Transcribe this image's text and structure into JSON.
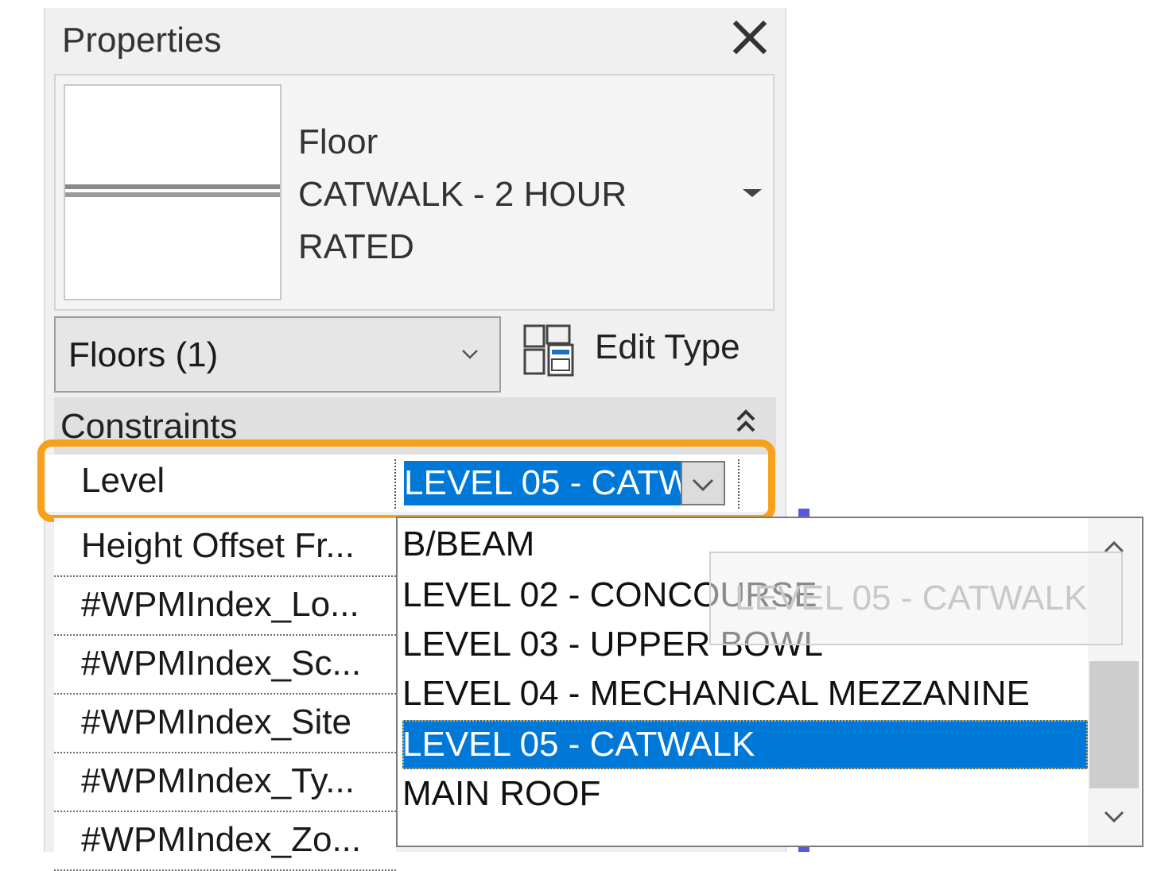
{
  "panel": {
    "title": "Properties"
  },
  "type_selector": {
    "family": "Floor",
    "type_line1": "CATWALK - 2 HOUR",
    "type_line2": "RATED"
  },
  "category_filter": {
    "value": "Floors (1)"
  },
  "edit_type": {
    "label": "Edit Type"
  },
  "group": {
    "label": "Constraints"
  },
  "level_row": {
    "label": "Level",
    "value": "LEVEL 05 - CATWALK"
  },
  "rows": [
    {
      "label": "Height Offset Fr..."
    },
    {
      "label": "#WPMIndex_Lo..."
    },
    {
      "label": "#WPMIndex_Sc..."
    },
    {
      "label": "#WPMIndex_Site"
    },
    {
      "label": "#WPMIndex_Ty..."
    },
    {
      "label": "#WPMIndex_Zo..."
    }
  ],
  "dropdown": {
    "options": [
      "B/BEAM",
      "LEVEL 02 - CONCOURSE",
      "LEVEL 03 - UPPER BOWL",
      "LEVEL 04 - MECHANICAL MEZZANINE",
      "LEVEL 05 - CATWALK",
      "MAIN ROOF"
    ],
    "selected_index": 4
  },
  "drag_ghost": {
    "text": "LEVEL 05 - CATWALK"
  },
  "colors": {
    "selection": "#0078d7",
    "highlight": "#f7a01a"
  }
}
